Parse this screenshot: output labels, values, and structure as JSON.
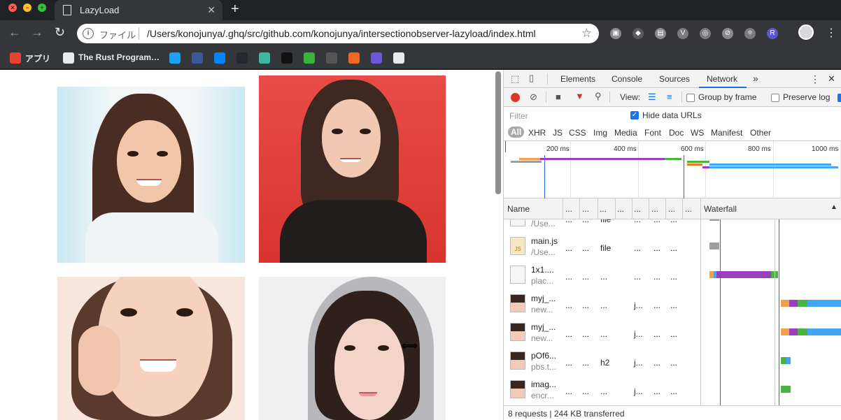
{
  "window": {
    "tab_title": "LazyLoad",
    "tab_close": "✕",
    "new_tab": "+"
  },
  "toolbar": {
    "back": "←",
    "forward": "→",
    "reload": "↻",
    "info": "i",
    "scheme": "ファイル",
    "url": "/Users/konojunya/.ghq/src/github.com/konojunya/intersectionobserver-lazyload/index.html",
    "star": "☆",
    "menu": "⋮",
    "extensions": [
      {
        "name": "camera-icon",
        "glyph": "▣",
        "color": "#8a8a8a"
      },
      {
        "name": "extension-icon",
        "glyph": "◆",
        "color": "#5a5a5a"
      },
      {
        "name": "chat-icon",
        "glyph": "▤",
        "color": "#8a8a8a"
      },
      {
        "name": "vue-icon",
        "glyph": "V",
        "color": "#7a7a7a"
      },
      {
        "name": "target-icon",
        "glyph": "◎",
        "color": "#7a7a7a"
      },
      {
        "name": "block-icon",
        "glyph": "⊘",
        "color": "#8a8a8a"
      },
      {
        "name": "react-icon",
        "glyph": "⚛",
        "color": "#7a7a7a"
      },
      {
        "name": "redux-icon",
        "glyph": "R",
        "color": "#5e57c9"
      }
    ]
  },
  "bookmarks": [
    {
      "name": "apps",
      "label": "アプリ",
      "icon": "grid-icon",
      "color": "#e94235"
    },
    {
      "name": "rust",
      "label": "The Rust Program…",
      "icon": "page-icon",
      "color": "#e8eaed"
    },
    {
      "name": "twitter",
      "label": "",
      "icon": "twitter-icon",
      "color": "#1da1f2"
    },
    {
      "name": "facebook",
      "label": "",
      "icon": "facebook-icon",
      "color": "#3b5998"
    },
    {
      "name": "messenger",
      "label": "",
      "icon": "messenger-icon",
      "color": "#0084ff"
    },
    {
      "name": "github",
      "label": "",
      "icon": "github-icon",
      "color": "#24292e"
    },
    {
      "name": "codesandbox",
      "label": "",
      "icon": "sandbox-icon",
      "color": "#3bb8a4"
    },
    {
      "name": "dev",
      "label": "",
      "icon": "dev-icon",
      "color": "#111111"
    },
    {
      "name": "quip",
      "label": "",
      "icon": "quip-icon",
      "color": "#38b43a"
    },
    {
      "name": "circleci",
      "label": "",
      "icon": "circle-icon",
      "color": "#555555"
    },
    {
      "name": "box",
      "label": "",
      "icon": "box-icon",
      "color": "#f26722"
    },
    {
      "name": "kotlin",
      "label": "",
      "icon": "kotlin-icon",
      "color": "#6b57d8"
    },
    {
      "name": "ghost",
      "label": "",
      "icon": "ghost-icon",
      "color": "#e8eaed"
    }
  ],
  "devtools": {
    "tabs": [
      "Elements",
      "Console",
      "Sources",
      "Network"
    ],
    "more": "»",
    "kebab": "⋮",
    "close": "✕",
    "toolbar": {
      "view_label": "View:",
      "group_by_frame": "Group by frame",
      "preserve_log": "Preserve log"
    },
    "filter_placeholder": "Filter",
    "hide_data_urls": "Hide data URLs",
    "types": [
      "All",
      "XHR",
      "JS",
      "CSS",
      "Img",
      "Media",
      "Font",
      "Doc",
      "WS",
      "Manifest",
      "Other"
    ],
    "ticks": [
      "200 ms",
      "400 ms",
      "600 ms",
      "800 ms",
      "1000 ms"
    ],
    "columns": {
      "name": "Name",
      "truncated": "...",
      "waterfall": "Waterfall",
      "sort": "▲"
    },
    "rows": [
      {
        "name": "",
        "path": "/Use...",
        "c1": "...",
        "c2": "...",
        "c3": "file",
        "c4": "...",
        "c5": "...",
        "c6": "...",
        "thumb": "file"
      },
      {
        "name": "main.js",
        "path": "/Use...",
        "c1": "...",
        "c2": "...",
        "c3": "file",
        "c4": "...",
        "c5": "...",
        "c6": "...",
        "thumb": "js"
      },
      {
        "name": "1x1....",
        "path": "plac...",
        "c1": "...",
        "c2": "...",
        "c3": "...",
        "c4": "...",
        "c5": "...",
        "c6": "...",
        "thumb": "blank"
      },
      {
        "name": "myj_...",
        "path": "new...",
        "c1": "...",
        "c2": "...",
        "c3": "...",
        "c4": "j...",
        "c5": "...",
        "c6": "...",
        "thumb": "photo"
      },
      {
        "name": "myj_...",
        "path": "new...",
        "c1": "...",
        "c2": "...",
        "c3": "...",
        "c4": "j...",
        "c5": "...",
        "c6": "...",
        "thumb": "photo"
      },
      {
        "name": "pOf6...",
        "path": "pbs.t...",
        "c1": "...",
        "c2": "...",
        "c3": "h2",
        "c4": "j...",
        "c5": "...",
        "c6": "...",
        "thumb": "photo"
      },
      {
        "name": "imag...",
        "path": "encr...",
        "c1": "...",
        "c2": "...",
        "c3": "...",
        "c4": "j...",
        "c5": "...",
        "c6": "...",
        "thumb": "photo"
      }
    ],
    "status": "8 requests | 244 KB transferred"
  },
  "page": {
    "photos": [
      {
        "name": "photo-top-left",
        "bg": "#f4f7f8"
      },
      {
        "name": "photo-top-right",
        "bg": "#e0413c"
      },
      {
        "name": "photo-bottom-left",
        "bg": "#f6e6dd"
      },
      {
        "name": "photo-bottom-right",
        "bg": "#f0f0f0"
      }
    ]
  }
}
